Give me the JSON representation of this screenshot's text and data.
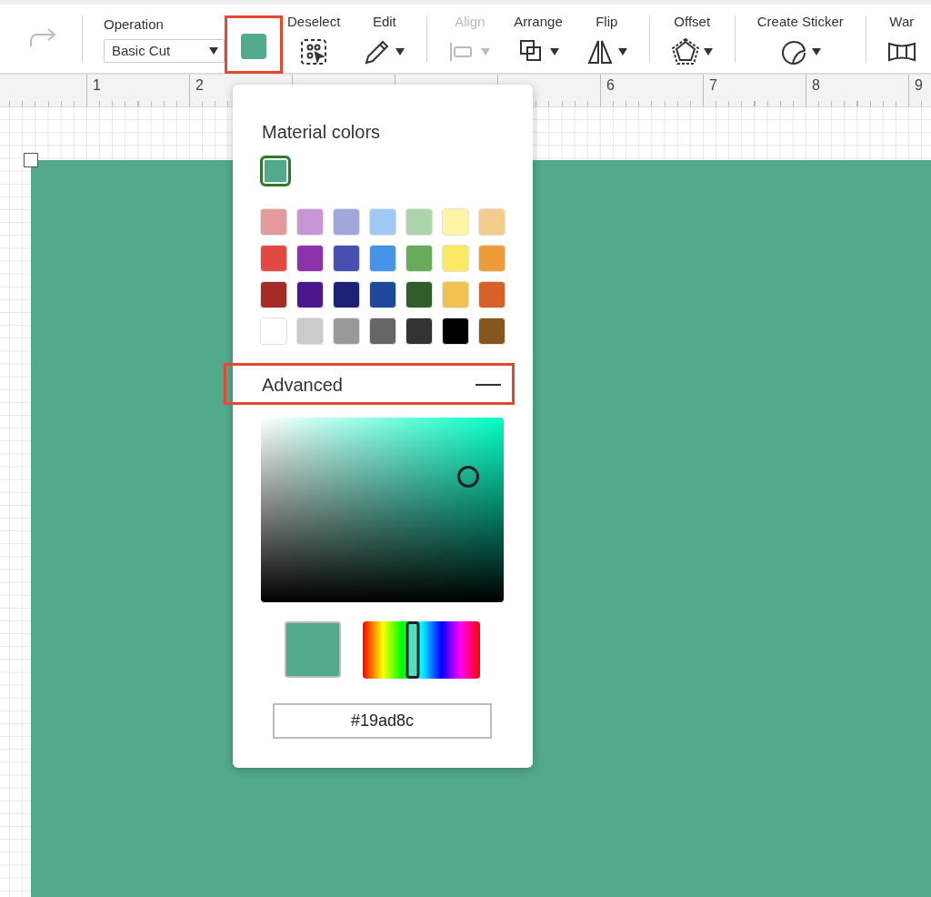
{
  "toolbar": {
    "redo": {
      "disabled": true
    },
    "operation": {
      "label": "Operation",
      "value": "Basic Cut"
    },
    "color_button": {
      "color": "#52a98b",
      "highlighted": true
    },
    "groups": [
      [
        {
          "label": "Deselect",
          "kind": "deselect",
          "disabled": false,
          "dropdown": false
        },
        {
          "label": "Edit",
          "kind": "edit",
          "disabled": false,
          "dropdown": true
        }
      ],
      [
        {
          "label": "Align",
          "kind": "align",
          "disabled": true,
          "dropdown": true
        },
        {
          "label": "Arrange",
          "kind": "arrange",
          "disabled": false,
          "dropdown": true
        },
        {
          "label": "Flip",
          "kind": "flip",
          "disabled": false,
          "dropdown": true
        }
      ],
      [
        {
          "label": "Offset",
          "kind": "offset",
          "disabled": false,
          "dropdown": true
        }
      ],
      [
        {
          "label": "Create Sticker",
          "kind": "sticker",
          "disabled": false,
          "dropdown": true
        }
      ],
      [
        {
          "label": "War",
          "kind": "warp",
          "disabled": false,
          "dropdown": false
        }
      ]
    ]
  },
  "ruler": {
    "before_popover": [
      "1",
      "2"
    ],
    "after_popover": [
      "6",
      "7",
      "8",
      "9"
    ]
  },
  "canvas": {
    "selected": true
  },
  "color_popover": {
    "title": "Material colors",
    "current": {
      "color": "#52a98b",
      "selected": true
    },
    "swatches": [
      {
        "color": "#e39a9a",
        "selected": false
      },
      {
        "color": "#c896d6",
        "selected": false
      },
      {
        "color": "#9fa8d8",
        "selected": false
      },
      {
        "color": "#9fc8f2",
        "selected": false
      },
      {
        "color": "#add5aa",
        "selected": false
      },
      {
        "color": "#fdf5a5",
        "selected": false
      },
      {
        "color": "#f4cc8e",
        "selected": false
      },
      {
        "color": "#e24a43",
        "selected": false
      },
      {
        "color": "#8d31ad",
        "selected": false
      },
      {
        "color": "#4650b0",
        "selected": false
      },
      {
        "color": "#4693ea",
        "selected": false
      },
      {
        "color": "#69ab5b",
        "selected": false
      },
      {
        "color": "#fbe964",
        "selected": false
      },
      {
        "color": "#ee9b39",
        "selected": false
      },
      {
        "color": "#a52b27",
        "selected": false
      },
      {
        "color": "#4a178c",
        "selected": false
      },
      {
        "color": "#1d2277",
        "selected": false
      },
      {
        "color": "#1f479a",
        "selected": false
      },
      {
        "color": "#315d2b",
        "selected": false
      },
      {
        "color": "#f0c350",
        "selected": false
      },
      {
        "color": "#d85f28",
        "selected": false
      },
      {
        "color": "#ffffff",
        "selected": false
      },
      {
        "color": "#cbcbcb",
        "selected": false
      },
      {
        "color": "#999999",
        "selected": false
      },
      {
        "color": "#666666",
        "selected": false
      },
      {
        "color": "#333333",
        "selected": false
      },
      {
        "color": "#000000",
        "selected": false
      },
      {
        "color": "#86561e",
        "selected": false
      }
    ],
    "advanced": {
      "title": "Advanced",
      "expanded": true,
      "highlighted": true,
      "hue_slider": {
        "level": 0.43
      },
      "hex": "#19ad8c"
    }
  }
}
